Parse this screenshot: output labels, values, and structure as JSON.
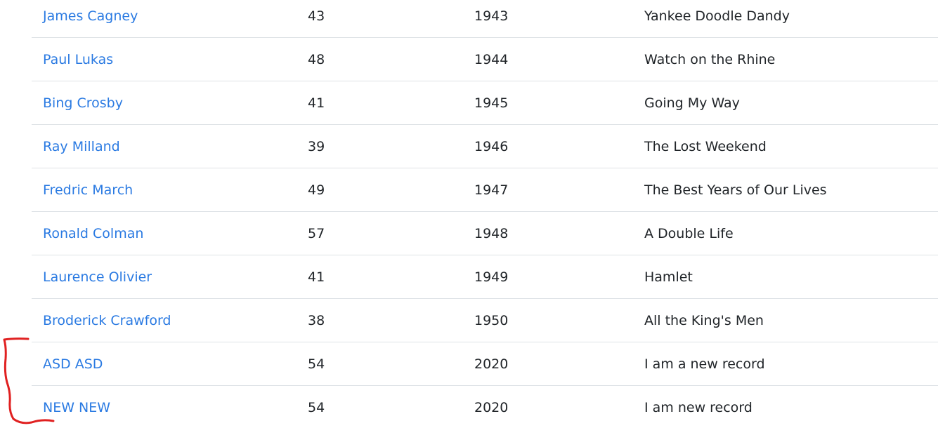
{
  "rows": [
    {
      "name": "James Cagney",
      "age": "43",
      "year": "1943",
      "movie": "Yankee Doodle Dandy"
    },
    {
      "name": "Paul Lukas",
      "age": "48",
      "year": "1944",
      "movie": "Watch on the Rhine"
    },
    {
      "name": "Bing Crosby",
      "age": "41",
      "year": "1945",
      "movie": "Going My Way"
    },
    {
      "name": "Ray Milland",
      "age": "39",
      "year": "1946",
      "movie": "The Lost Weekend"
    },
    {
      "name": "Fredric March",
      "age": "49",
      "year": "1947",
      "movie": "The Best Years of Our Lives"
    },
    {
      "name": "Ronald Colman",
      "age": "57",
      "year": "1948",
      "movie": "A Double Life"
    },
    {
      "name": "Laurence Olivier",
      "age": "41",
      "year": "1949",
      "movie": "Hamlet"
    },
    {
      "name": "Broderick Crawford",
      "age": "38",
      "year": "1950",
      "movie": "All the King's Men"
    },
    {
      "name": "ASD ASD",
      "age": "54",
      "year": "2020",
      "movie": "I am a new record"
    },
    {
      "name": "NEW NEW",
      "age": "54",
      "year": "2020",
      "movie": "I am new record"
    }
  ],
  "colors": {
    "link": "#2a7ae2",
    "text": "#212529",
    "divider": "#dee2e6",
    "annotation": "#e02020"
  }
}
